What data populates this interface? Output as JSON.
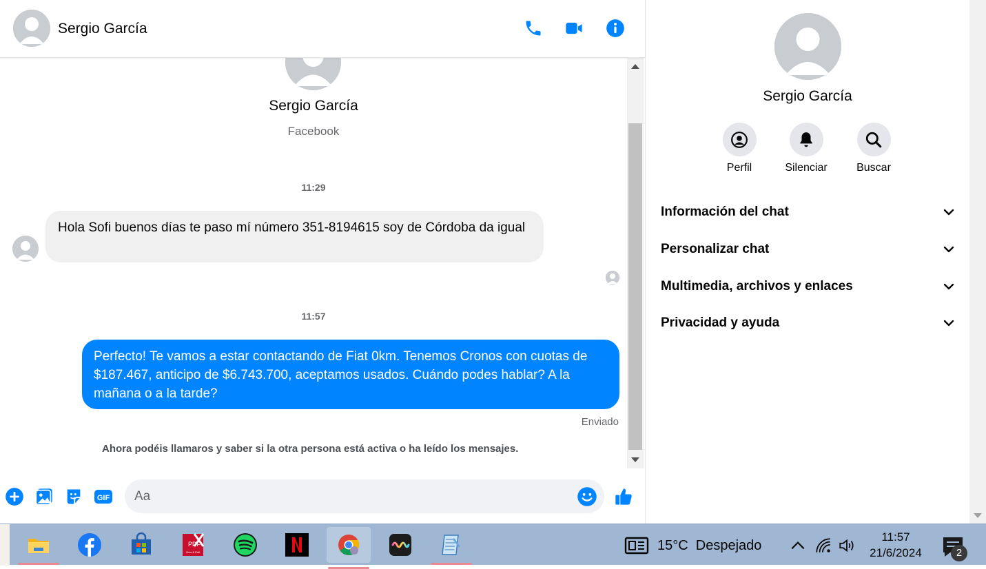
{
  "chat": {
    "contact_name": "Sergio García",
    "contact_source": "Facebook",
    "timestamp_1": "11:29",
    "incoming_message": "Hola Sofi buenos días te paso mí número 351-8194615 soy de Córdoba da igual",
    "timestamp_2": "11:57",
    "outgoing_message": "Perfecto! Te vamos a estar contactando de Fiat 0km. Tenemos Cronos con cuotas de $187.467, anticipo de $6.743.700, aceptamos usados. Cuándo podes hablar? A la mañana o a la tarde?",
    "status": "Enviado",
    "notice": "Ahora podéis llamaros y saber si la otra persona está activa o ha leído los mensajes."
  },
  "header": {
    "icons": [
      "phone-icon",
      "video-icon",
      "info-icon"
    ]
  },
  "composer": {
    "placeholder": "Aa",
    "icons": [
      "plus-icon",
      "image-icon",
      "sticker-icon",
      "gif-icon",
      "emoji-icon",
      "like-icon"
    ]
  },
  "panel": {
    "name": "Sergio García",
    "actions": [
      {
        "label": "Perfil",
        "icon": "profile-icon"
      },
      {
        "label": "Silenciar",
        "icon": "bell-icon"
      },
      {
        "label": "Buscar",
        "icon": "search-icon"
      }
    ],
    "sections": [
      "Información del chat",
      "Personalizar chat",
      "Multimedia, archivos y enlaces",
      "Privacidad y ayuda"
    ]
  },
  "taskbar": {
    "apps": [
      "file-explorer-icon",
      "facebook-icon",
      "microsoft-store-icon",
      "pdf-editor-icon",
      "spotify-icon",
      "netflix-icon",
      "chrome-icon",
      "sound-app-icon",
      "notepad-icon"
    ],
    "weather": "15°C  Despejado",
    "time": "11:57",
    "date": "21/6/2024",
    "notification_count": "2"
  },
  "colors": {
    "messenger_blue": "#0084ff",
    "bubble_gray": "#f0f0f0",
    "taskbar": "#9fb7d3"
  }
}
